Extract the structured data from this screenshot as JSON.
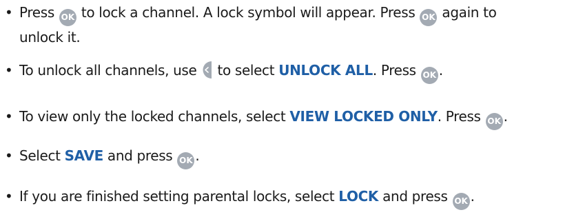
{
  "bullets": [
    {
      "seg1": "Press",
      "seg2": "to lock a channel. A lock symbol will appear. Press",
      "seg3": "again to",
      "seg4": "unlock it."
    },
    {
      "seg1": "To unlock all channels, use",
      "seg2": "to select",
      "keyword": "UNLOCK ALL",
      "seg3": ". Press",
      "seg4": "."
    },
    {
      "seg1": "To view only the locked channels, select",
      "keyword": "VIEW LOCKED ONLY",
      "seg2": ". Press",
      "seg3": "."
    },
    {
      "seg1": "Select",
      "keyword": "SAVE",
      "seg2": "and press",
      "seg3": "."
    },
    {
      "seg1": "If you are finished setting parental locks, select",
      "keyword": "LOCK",
      "seg2": "and press",
      "seg3": "."
    }
  ],
  "button_label": "OK",
  "colors": {
    "keyword": "#1f5fa6",
    "button_bg": "#a3aab3",
    "text": "#1a1a1a"
  },
  "icons": {
    "ok_button": "ok-button-icon",
    "left_button": "left-arrow-button-icon"
  }
}
